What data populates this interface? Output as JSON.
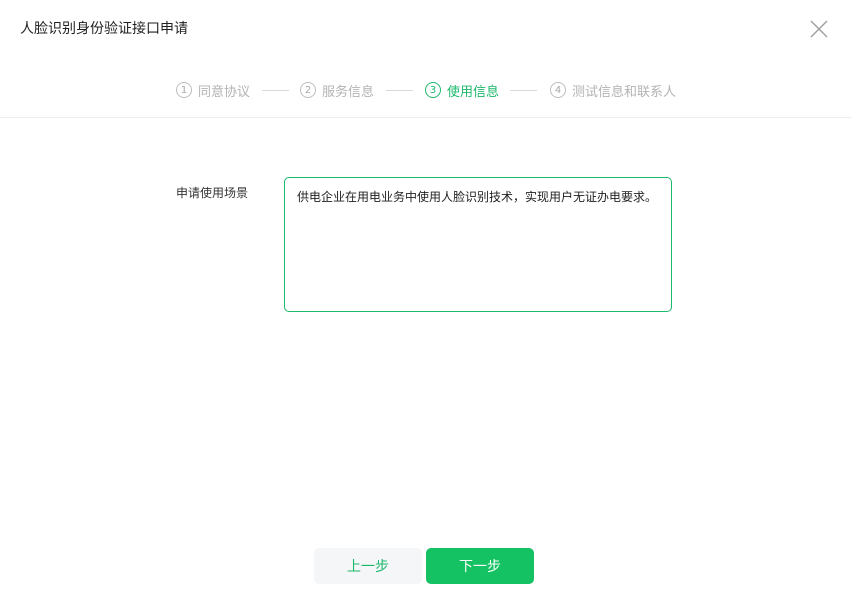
{
  "dialog": {
    "title": "人脸识别身份验证接口申请",
    "close_icon": "close-icon"
  },
  "steps": [
    {
      "number": "1",
      "label": "同意协议",
      "state": "inactive"
    },
    {
      "number": "2",
      "label": "服务信息",
      "state": "inactive"
    },
    {
      "number": "3",
      "label": "使用信息",
      "state": "active"
    },
    {
      "number": "4",
      "label": "测试信息和联系人",
      "state": "inactive"
    }
  ],
  "form": {
    "scene_label": "申请使用场景",
    "scene_value": "供电企业在用电业务中使用人脸识别技术，实现用户无证办电要求。"
  },
  "buttons": {
    "prev_label": "上一步",
    "next_label": "下一步"
  },
  "colors": {
    "accent": "#1cb86b",
    "primary_button": "#14c264",
    "secondary_button_bg": "#f4f6f7",
    "inactive_step": "#b3b3b3"
  }
}
